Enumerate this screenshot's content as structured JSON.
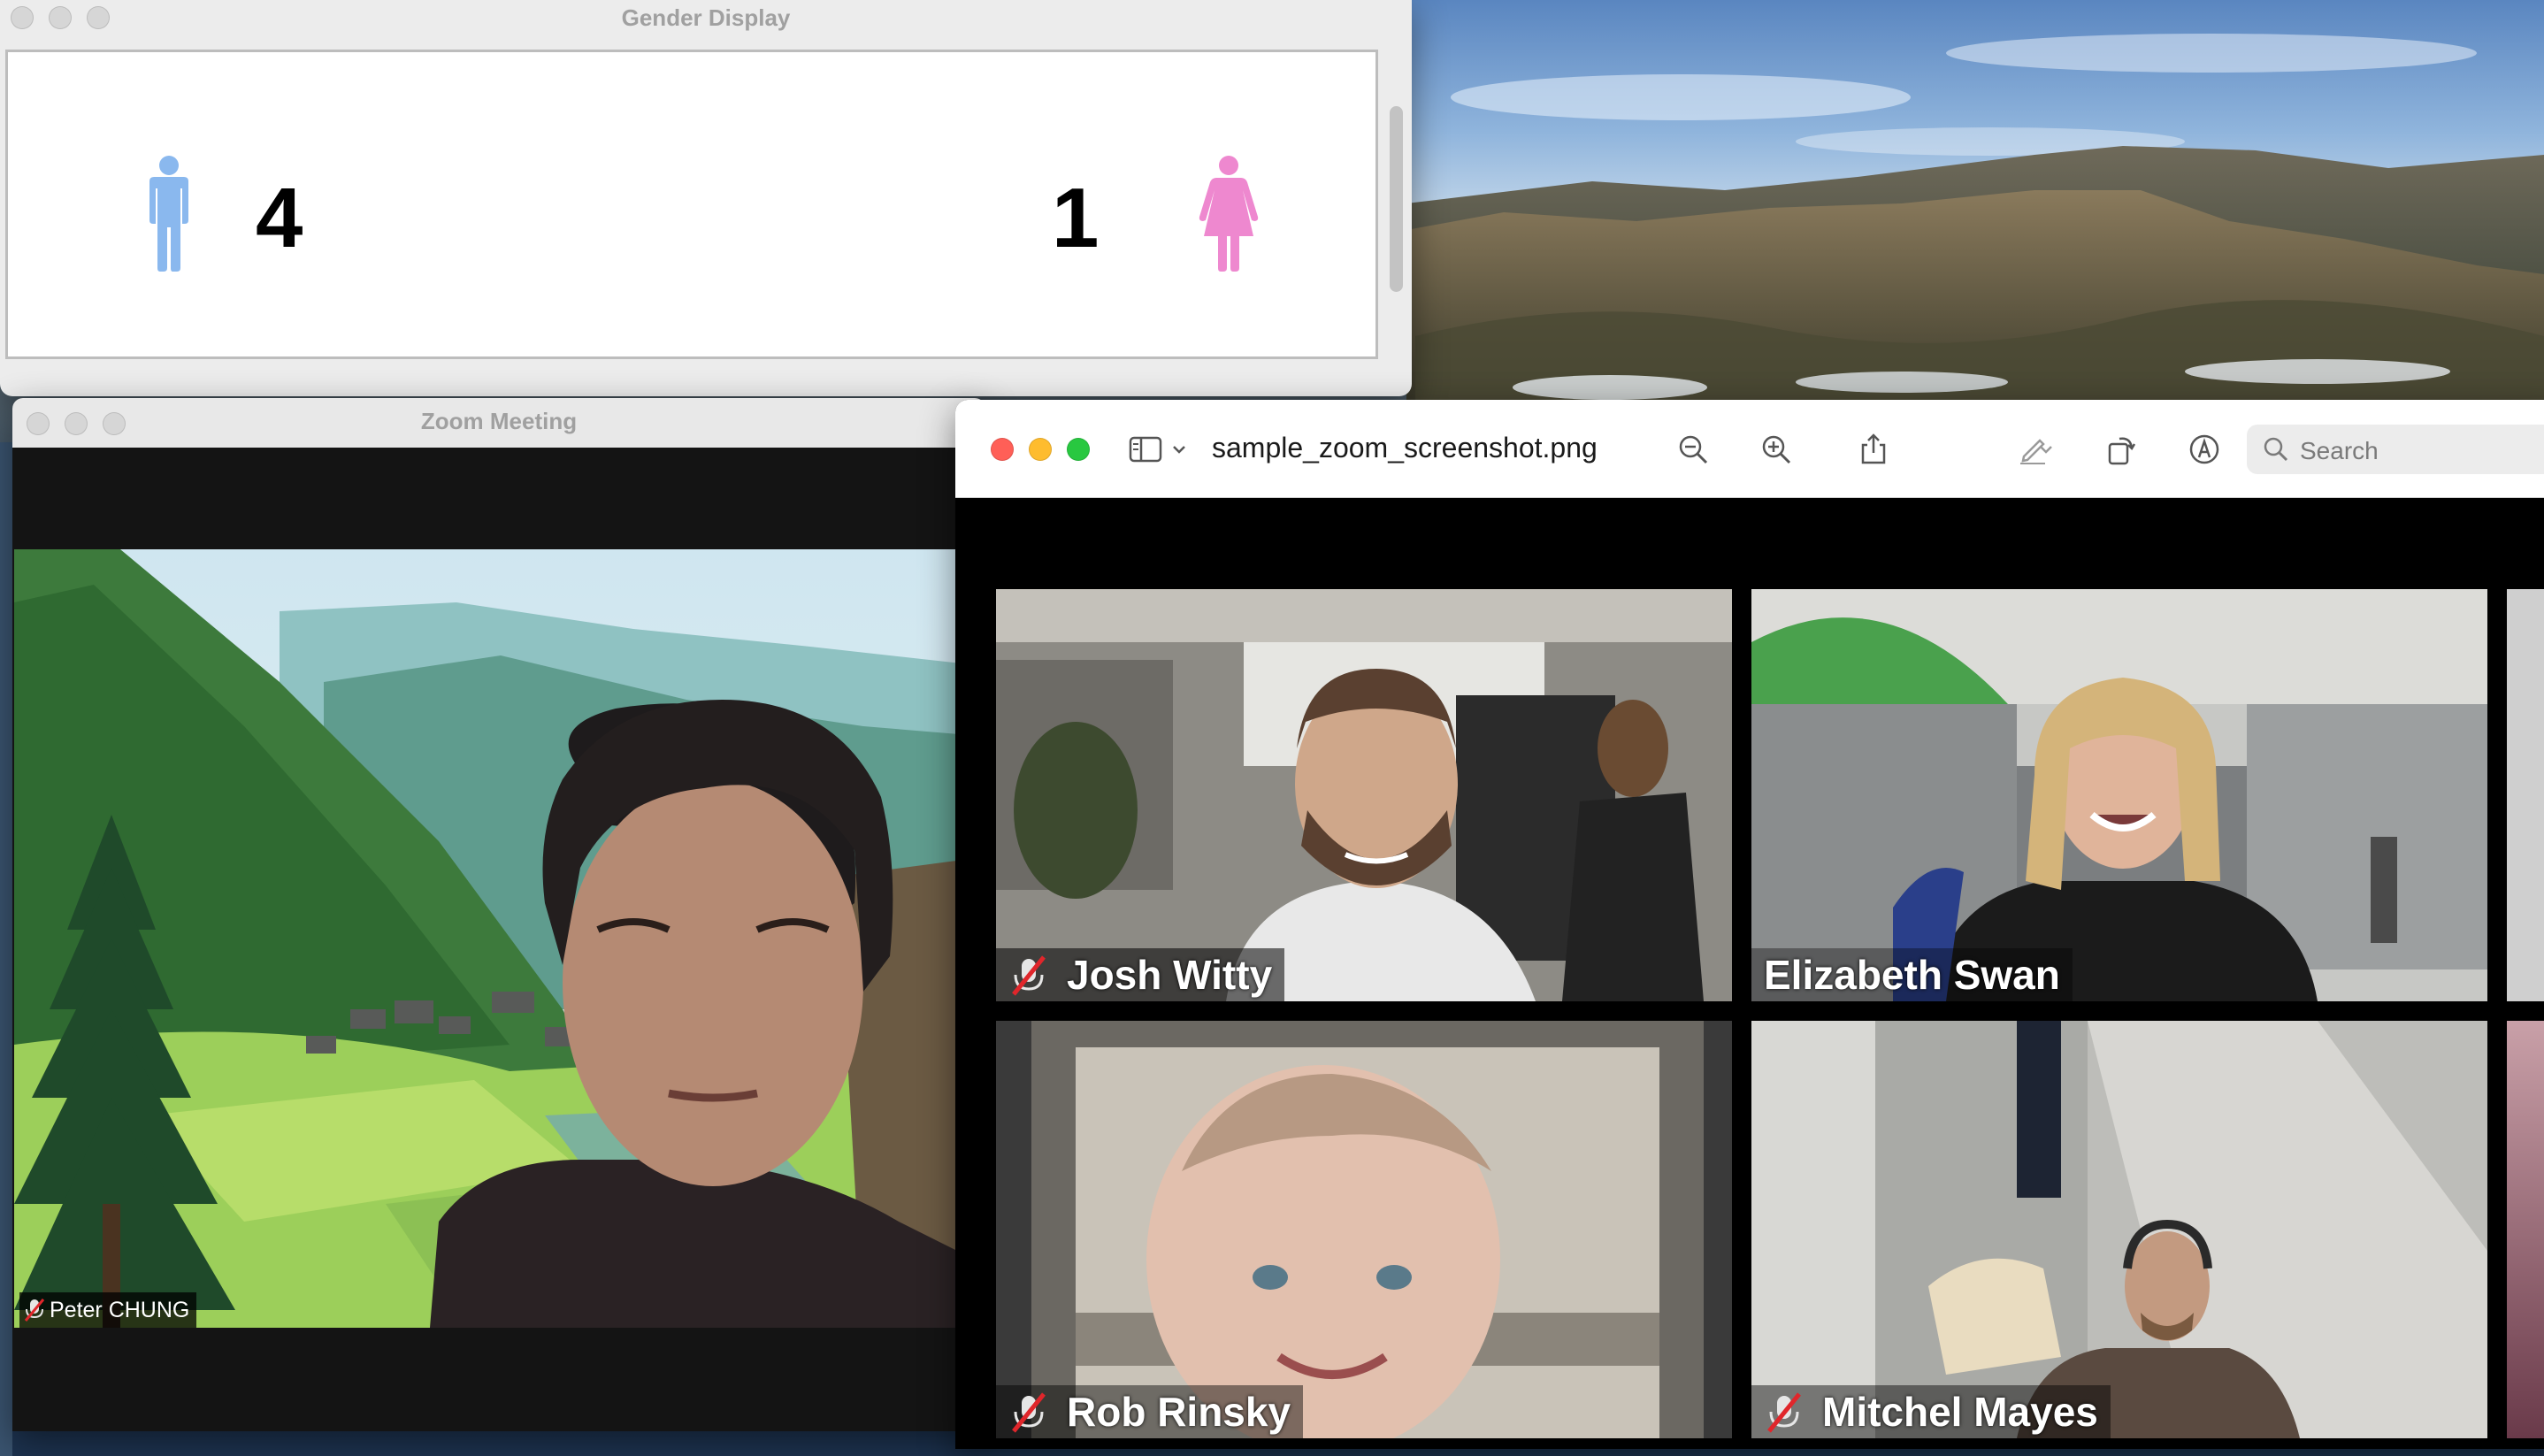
{
  "gender_window": {
    "title": "Gender Display",
    "male": {
      "icon": "male-person-icon",
      "count": "4",
      "color": "#8ab8ee"
    },
    "female": {
      "icon": "female-person-icon",
      "count": "1",
      "color": "#ee88cf"
    }
  },
  "zoom_window": {
    "title": "Zoom Meeting",
    "self_name": "Peter CHUNG",
    "mute_icon": "muted-microphone-icon"
  },
  "preview_window": {
    "file_title": "sample_zoom_screenshot.png",
    "search_placeholder": "Search",
    "toolbar_icons": [
      "sidebar-icon",
      "chevron-down-icon",
      "zoom-out-icon",
      "zoom-in-icon",
      "share-icon",
      "markup-pen-icon",
      "chevron-down-icon",
      "rotate-icon",
      "annotate-icon",
      "search-icon"
    ],
    "participants": [
      {
        "name": "Josh Witty"
      },
      {
        "name": "Elizabeth Swan"
      },
      {
        "name": "Rob Rinsky"
      },
      {
        "name": "Mitchel Mayes"
      }
    ]
  },
  "colors": {
    "traffic_red": "#ff5f57",
    "traffic_yellow": "#febc2e",
    "traffic_green": "#28c840"
  }
}
